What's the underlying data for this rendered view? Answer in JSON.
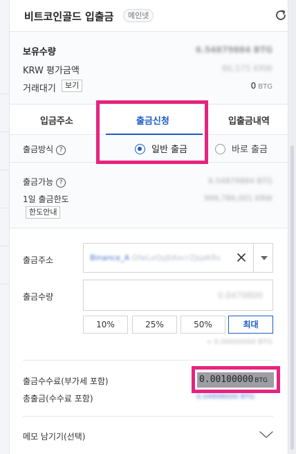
{
  "header": {
    "title": "비트코인골드 입출금",
    "network_badge": "메인넷"
  },
  "balance": {
    "holdings_label": "보유수량",
    "holdings_value": "6.54879884 BTG",
    "krw_label": "KRW 평가금액",
    "krw_value": "86,575 KRW",
    "pending_label": "거래대기",
    "view_button": "보기",
    "pending_value": "0",
    "pending_unit": "BTG"
  },
  "tabs": [
    {
      "label": "입금주소",
      "active": false
    },
    {
      "label": "출금신청",
      "active": true
    },
    {
      "label": "입출금내역",
      "active": false
    }
  ],
  "method": {
    "label": "출금방식",
    "help": "?",
    "options": [
      {
        "label": "일반 출금",
        "selected": true
      },
      {
        "label": "바로 출금",
        "selected": false
      }
    ]
  },
  "availability": {
    "available_label": "출금가능",
    "help": "?",
    "available_value": "6.54879884 BTG",
    "daily_limit_label": "1일 출금한도",
    "daily_limit_value": "999,786,001 KRW",
    "limit_guide_button": "한도안내"
  },
  "form": {
    "address_label": "출금주소",
    "address_prefix": "Binance_A",
    "address_rest": "GfwLoQyJbKecrZJqaKRs",
    "quantity_label": "출금수량",
    "quantity_value": "0.0479800",
    "percent_buttons": [
      "10%",
      "25%",
      "50%"
    ],
    "max_button": "최대",
    "note": "= 0.00000000 BTG"
  },
  "fees": {
    "fee_label": "출금수수료(부가세 포함)",
    "fee_value": "0.00100000",
    "fee_unit": "BTG",
    "total_label": "총출금(수수료 포함)",
    "total_value": "0.04898000 BTG"
  },
  "memo": {
    "label": "메모 남기기(선택)"
  },
  "colors": {
    "accent": "#1a5bc4",
    "highlight": "#e6247f",
    "fee_background": "#9c9ea3"
  }
}
